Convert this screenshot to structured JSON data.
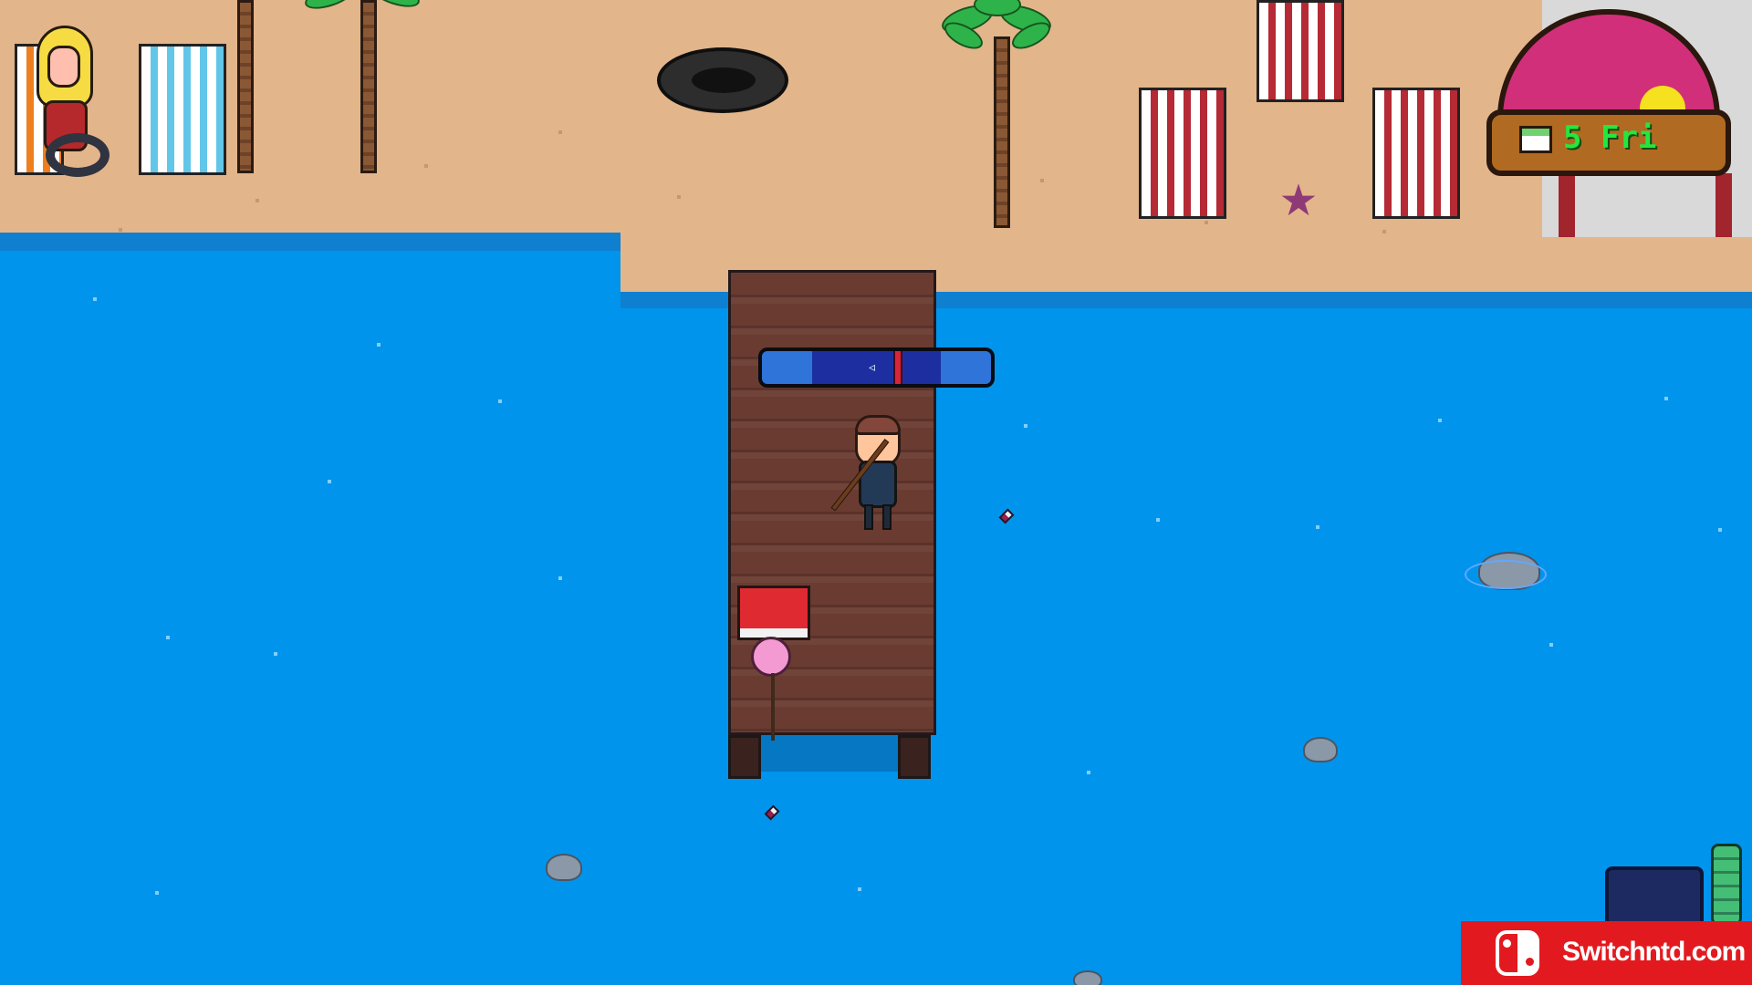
{
  "hud": {
    "calendar": {
      "day_number": "5",
      "weekday": "Fri",
      "icon": "calendar-icon"
    }
  },
  "fishing": {
    "meter": {
      "marker_position": 0.61,
      "fish_icon": "fish-icon"
    }
  },
  "watermark": {
    "text": "Switchntd.com",
    "logo": "nintendo-switch-logo"
  },
  "theme": {
    "water": "#0094ec",
    "sand": "#e3b58b",
    "pier": "#6a3c31",
    "calendar_text": "#25e63d",
    "watermark_bg": "#e21a1f"
  }
}
